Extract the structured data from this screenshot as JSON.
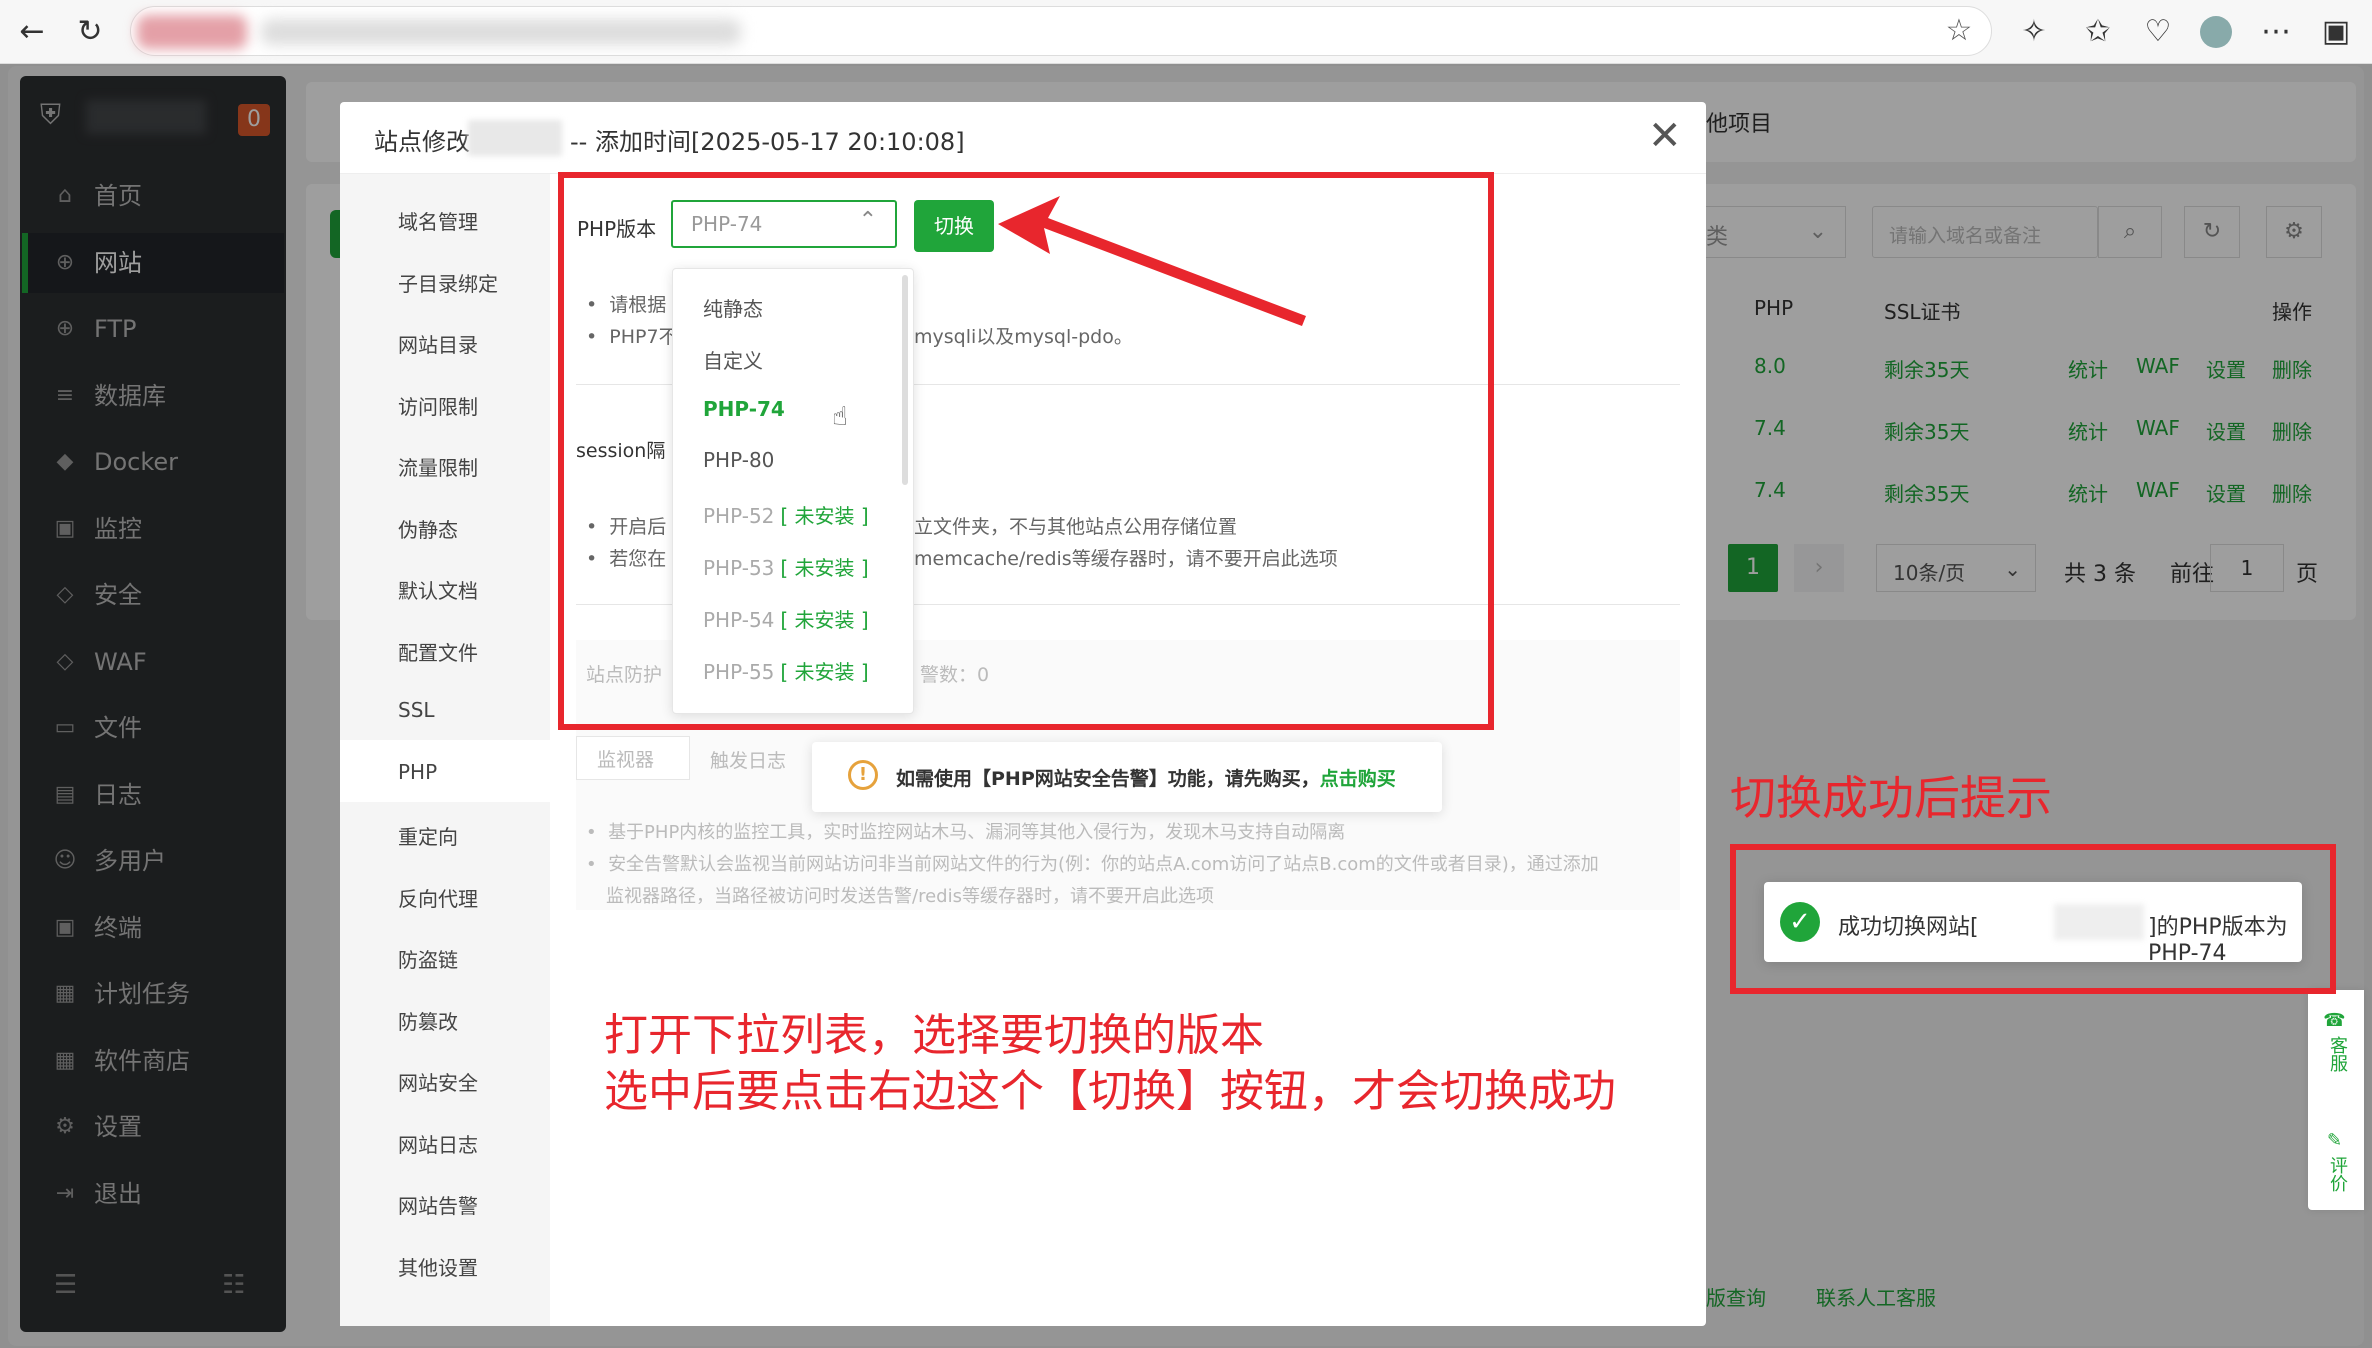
{
  "sidebar": {
    "badge": "0",
    "items": [
      {
        "label": "首页",
        "icon": "home-icon",
        "glyph": "⌂"
      },
      {
        "label": "网站",
        "icon": "globe-icon",
        "glyph": "⊕"
      },
      {
        "label": "FTP",
        "icon": "ftp-icon",
        "glyph": "⊕"
      },
      {
        "label": "数据库",
        "icon": "database-icon",
        "glyph": "≡"
      },
      {
        "label": "Docker",
        "icon": "docker-icon",
        "glyph": "◆"
      },
      {
        "label": "监控",
        "icon": "monitor-icon",
        "glyph": "▣"
      },
      {
        "label": "安全",
        "icon": "shield-icon",
        "glyph": "◇"
      },
      {
        "label": "WAF",
        "icon": "waf-icon",
        "glyph": "◇"
      },
      {
        "label": "文件",
        "icon": "folder-icon",
        "glyph": "▭"
      },
      {
        "label": "日志",
        "icon": "log-icon",
        "glyph": "▤"
      },
      {
        "label": "多用户",
        "icon": "users-icon",
        "glyph": "☺"
      },
      {
        "label": "终端",
        "icon": "terminal-icon",
        "glyph": "▣"
      },
      {
        "label": "计划任务",
        "icon": "calendar-icon",
        "glyph": "▦"
      },
      {
        "label": "软件商店",
        "icon": "apps-icon",
        "glyph": "▦"
      },
      {
        "label": "设置",
        "icon": "gear-icon",
        "glyph": "⚙"
      },
      {
        "label": "退出",
        "icon": "logout-icon",
        "glyph": "⇥"
      }
    ]
  },
  "background": {
    "tab_other": "他项目",
    "category_select": "类",
    "search_placeholder": "请输入域名或备注",
    "col_php": "PHP",
    "col_ssl": "SSL证书",
    "col_ops": "操作",
    "rows": [
      {
        "php": "8.0",
        "ssl": "剩余35天"
      },
      {
        "php": "7.4",
        "ssl": "剩余35天"
      },
      {
        "php": "7.4",
        "ssl": "剩余35天"
      }
    ],
    "ops": {
      "stats": "统计",
      "waf": "WAF",
      "settings": "设置",
      "delete": "删除"
    },
    "pager": {
      "current": "1",
      "per_page": "10条/页",
      "total": "共 3 条",
      "goto": "前往",
      "page_input": "1",
      "page_unit": "页"
    },
    "footer_links": [
      "版查询",
      "联系人工客服"
    ]
  },
  "modal": {
    "title_prefix": "站点修改",
    "title_suffix": "-- 添加时间[2025-05-17 20:10:08]",
    "tabs": [
      "域名管理",
      "子目录绑定",
      "网站目录",
      "访问限制",
      "流量限制",
      "伪静态",
      "默认文档",
      "配置文件",
      "SSL",
      "PHP",
      "重定向",
      "反向代理",
      "防盗链",
      "防篡改",
      "网站安全",
      "网站日志",
      "网站告警",
      "其他设置"
    ],
    "active_tab": "PHP",
    "php_label": "PHP版本",
    "php_value": "PHP-74",
    "switch_button": "切换",
    "notes1": [
      "请根据",
      "PHP7不"
    ],
    "notes1_tail": "mysqli以及mysql-pdo。",
    "session_label": "session隔",
    "notes2_a": "开启后",
    "notes2_a_tail": "立文件夹，不与其他站点公用存储位置",
    "notes2_b": "若您在",
    "notes2_b_tail": "memcache/redis等缓存器时，请不要开启此选项",
    "faint_a": "站点防护",
    "faint_b": "警数：0",
    "faint_c": "监视器",
    "faint_d": "触发日志",
    "faint_note1": "基于PHP内核的监控工具，实时监控网站木马、漏洞等其他入侵行为，发现木马支持自动隔离",
    "faint_note2": "安全告警默认会监视当前网站访问非当前网站文件的行为(例：你的站点A.com访问了站点B.com的文件或者目录)，通过添加",
    "faint_note3": "监视器路径，当路径被访问时发送告警/redis等缓存器时，请不要开启此选项",
    "dropdown": [
      {
        "label": "纯静态",
        "state": "normal"
      },
      {
        "label": "自定义",
        "state": "normal"
      },
      {
        "label": "PHP-74",
        "state": "selected"
      },
      {
        "label": "PHP-80",
        "state": "normal"
      },
      {
        "label": "PHP-52",
        "state": "disabled",
        "tag": "[ 未安装 ]"
      },
      {
        "label": "PHP-53",
        "state": "disabled",
        "tag": "[ 未安装 ]"
      },
      {
        "label": "PHP-54",
        "state": "disabled",
        "tag": "[ 未安装 ]"
      },
      {
        "label": "PHP-55",
        "state": "disabled",
        "tag": "[ 未安装 ]"
      }
    ],
    "alert_text": "如需使用【PHP网站安全告警】功能，请先购买，",
    "alert_link": "点击购买"
  },
  "annotations": {
    "success_hint": "切换成功后提示",
    "instruction_line1": "打开下拉列表，选择要切换的版本",
    "instruction_line2": "选中后要点击右边这个【切换】按钮，才会切换成功"
  },
  "toast": {
    "text_before": "成功切换网站[",
    "text_after": "]的PHP版本为PHP-74"
  },
  "float": {
    "service": "客服",
    "rate": "评价"
  },
  "colors": {
    "accent": "#20a53a",
    "annotation": "#e8262d"
  }
}
